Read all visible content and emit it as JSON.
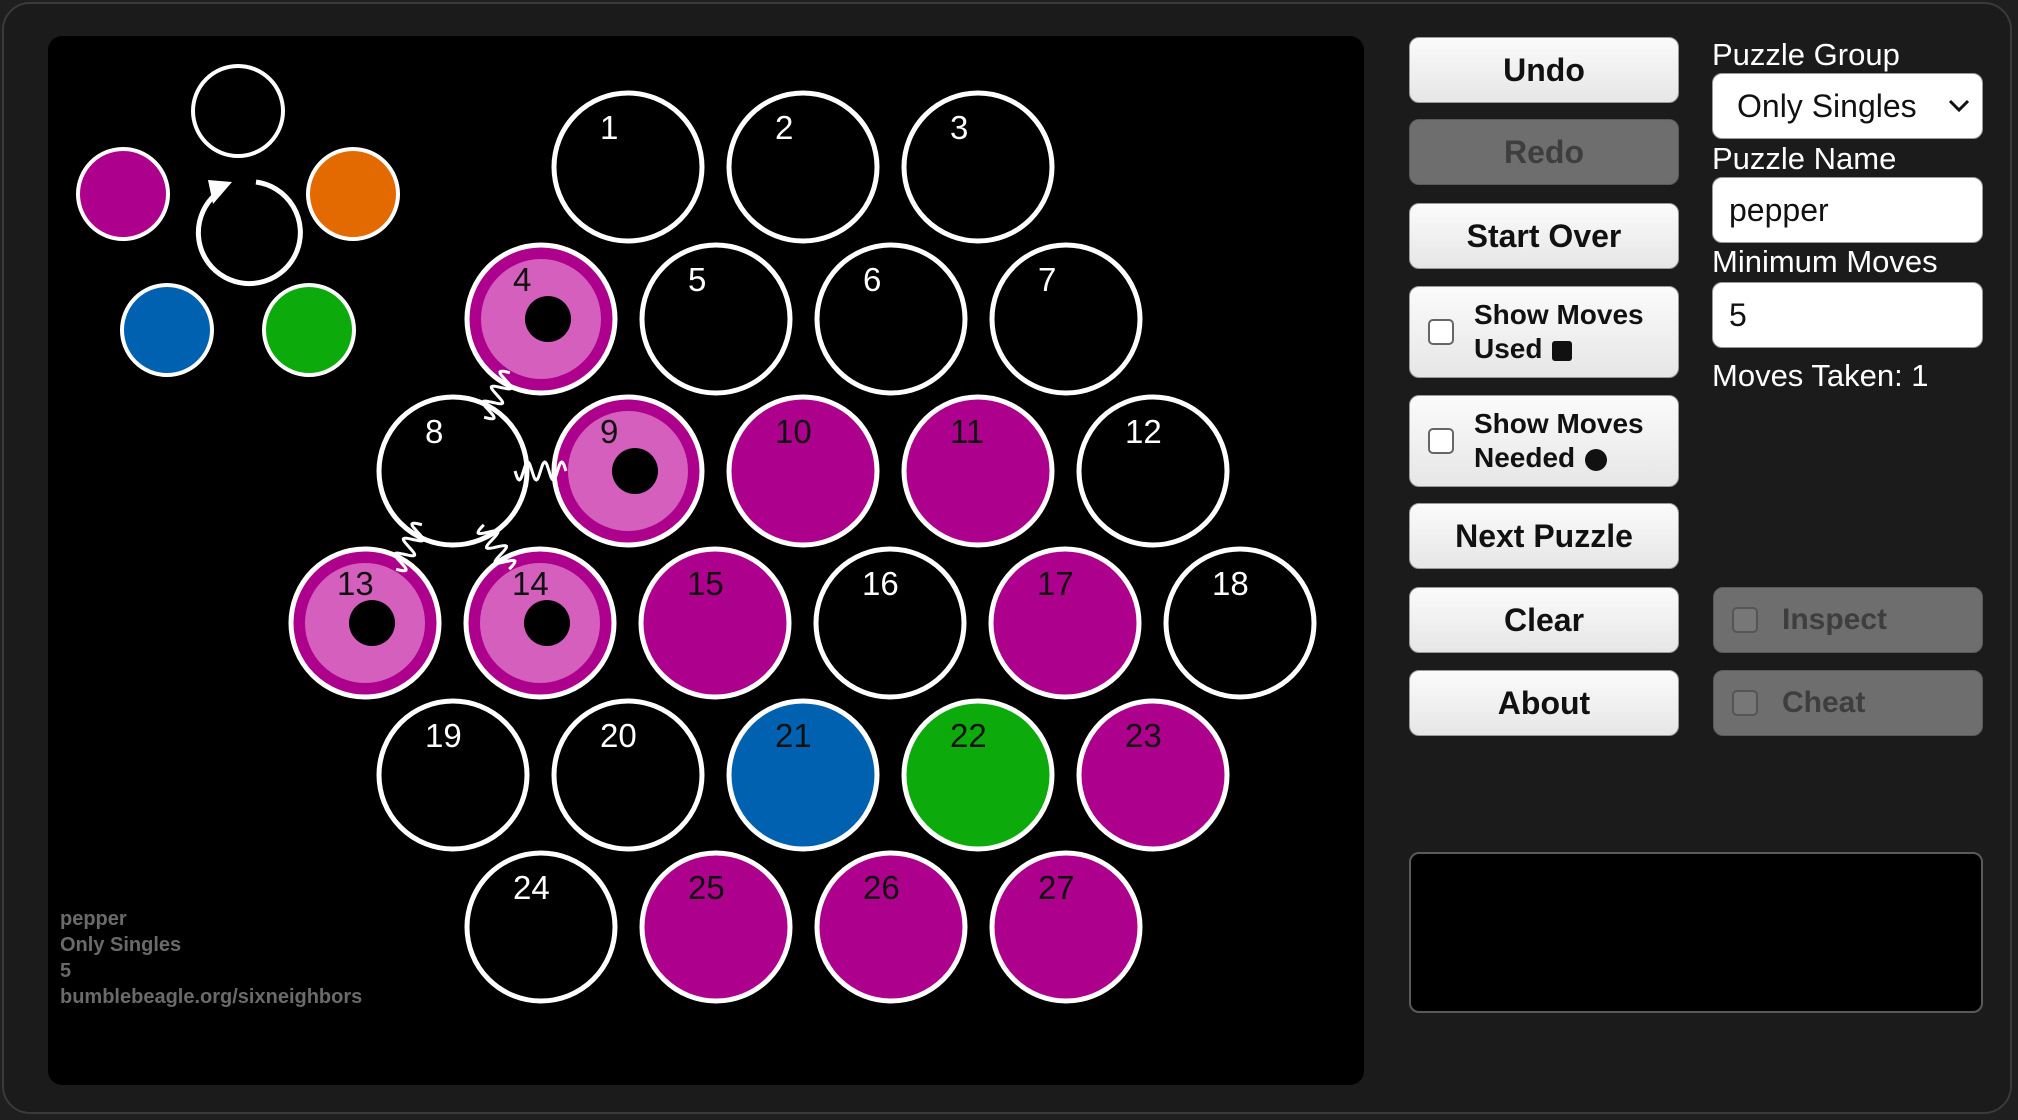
{
  "buttons": {
    "undo": "Undo",
    "redo": "Redo",
    "start_over": "Start Over",
    "show_moves_used_line1": "Show Moves",
    "show_moves_used_line2": "Used",
    "show_moves_needed_line1": "Show Moves",
    "show_moves_needed_line2": "Needed",
    "next_puzzle": "Next Puzzle",
    "clear": "Clear",
    "about": "About",
    "inspect": "Inspect",
    "cheat": "Cheat"
  },
  "panel": {
    "puzzle_group_label": "Puzzle Group",
    "puzzle_group_value": "Only Singles",
    "puzzle_name_label": "Puzzle Name",
    "puzzle_name_value": "pepper",
    "minimum_moves_label": "Minimum Moves",
    "minimum_moves_value": "5",
    "moves_taken": "Moves Taken: 1"
  },
  "board_info": {
    "line1": "pepper",
    "line2": "Only Singles",
    "line3": "5",
    "line4": "bumblebeagle.org/sixneighbors"
  },
  "colors": {
    "magenta": "#ad008c",
    "pink": "#d45fbd",
    "blue": "#0061b0",
    "green": "#0cab0b",
    "orange": "#e36a00",
    "empty": "#000000",
    "ring": "#ffffff"
  },
  "palette": [
    "empty",
    "magenta",
    "orange",
    "blue",
    "green"
  ],
  "cells": [
    {
      "n": "1",
      "state": "empty"
    },
    {
      "n": "2",
      "state": "empty"
    },
    {
      "n": "3",
      "state": "empty"
    },
    {
      "n": "4",
      "state": "selected"
    },
    {
      "n": "5",
      "state": "empty"
    },
    {
      "n": "6",
      "state": "empty"
    },
    {
      "n": "7",
      "state": "empty"
    },
    {
      "n": "8",
      "state": "empty"
    },
    {
      "n": "9",
      "state": "selected"
    },
    {
      "n": "10",
      "state": "magenta"
    },
    {
      "n": "11",
      "state": "magenta"
    },
    {
      "n": "12",
      "state": "empty"
    },
    {
      "n": "13",
      "state": "selected"
    },
    {
      "n": "14",
      "state": "selected"
    },
    {
      "n": "15",
      "state": "magenta"
    },
    {
      "n": "16",
      "state": "empty"
    },
    {
      "n": "17",
      "state": "magenta"
    },
    {
      "n": "18",
      "state": "empty"
    },
    {
      "n": "19",
      "state": "empty"
    },
    {
      "n": "20",
      "state": "empty"
    },
    {
      "n": "21",
      "state": "blue"
    },
    {
      "n": "22",
      "state": "green"
    },
    {
      "n": "23",
      "state": "magenta"
    },
    {
      "n": "24",
      "state": "empty"
    },
    {
      "n": "25",
      "state": "magenta"
    },
    {
      "n": "26",
      "state": "magenta"
    },
    {
      "n": "27",
      "state": "magenta"
    }
  ],
  "links": [
    [
      "4",
      "8"
    ],
    [
      "8",
      "9"
    ],
    [
      "8",
      "13"
    ],
    [
      "8",
      "14"
    ]
  ]
}
